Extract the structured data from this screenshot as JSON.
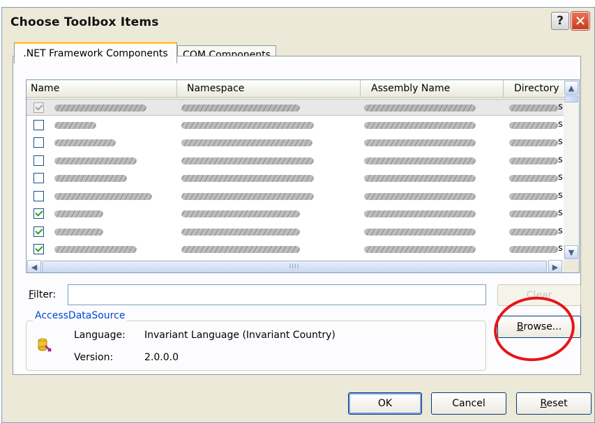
{
  "window": {
    "title": "Choose Toolbox Items",
    "help_label": "?",
    "close_label": "✕"
  },
  "tabs": [
    {
      "label": ".NET Framework Components",
      "active": true
    },
    {
      "label": "COM Components",
      "active": false
    }
  ],
  "list": {
    "columns": [
      "Name",
      "Namespace",
      "Assembly Name",
      "Directory"
    ],
    "rows": [
      {
        "checked": true,
        "enabled": false,
        "selected": true
      },
      {
        "checked": false,
        "enabled": true,
        "selected": false
      },
      {
        "checked": false,
        "enabled": true,
        "selected": false
      },
      {
        "checked": false,
        "enabled": true,
        "selected": false
      },
      {
        "checked": false,
        "enabled": true,
        "selected": false
      },
      {
        "checked": false,
        "enabled": true,
        "selected": false
      },
      {
        "checked": true,
        "enabled": true,
        "selected": false
      },
      {
        "checked": true,
        "enabled": true,
        "selected": false
      },
      {
        "checked": true,
        "enabled": true,
        "selected": false
      }
    ],
    "dir_fragment": "s",
    "scroll_up_icon": "▲",
    "scroll_down_icon": "▼",
    "scroll_left_icon": "◀",
    "scroll_right_icon": "▶",
    "grip_label": "IIII"
  },
  "filter": {
    "label_prefix": "F",
    "label_rest": "ilter:",
    "value": "",
    "clear_label": "Clear"
  },
  "details": {
    "group_title": "AccessDataSource",
    "language_label": "Language:",
    "language_value": "Invariant Language (Invariant Country)",
    "version_label": "Version:",
    "version_value": "2.0.0.0",
    "icon": "component-icon"
  },
  "buttons": {
    "browse": {
      "underline": "B",
      "rest": "rowse..."
    },
    "ok": "OK",
    "cancel": "Cancel",
    "reset": {
      "underline": "R",
      "rest": "eset"
    }
  },
  "colors": {
    "dialog_bg": "#ece9d8",
    "active_tab_accent": "#ffc83c",
    "group_title": "#0046d5",
    "annotation_circle": "#e8141a",
    "check_green": "#21a121"
  }
}
